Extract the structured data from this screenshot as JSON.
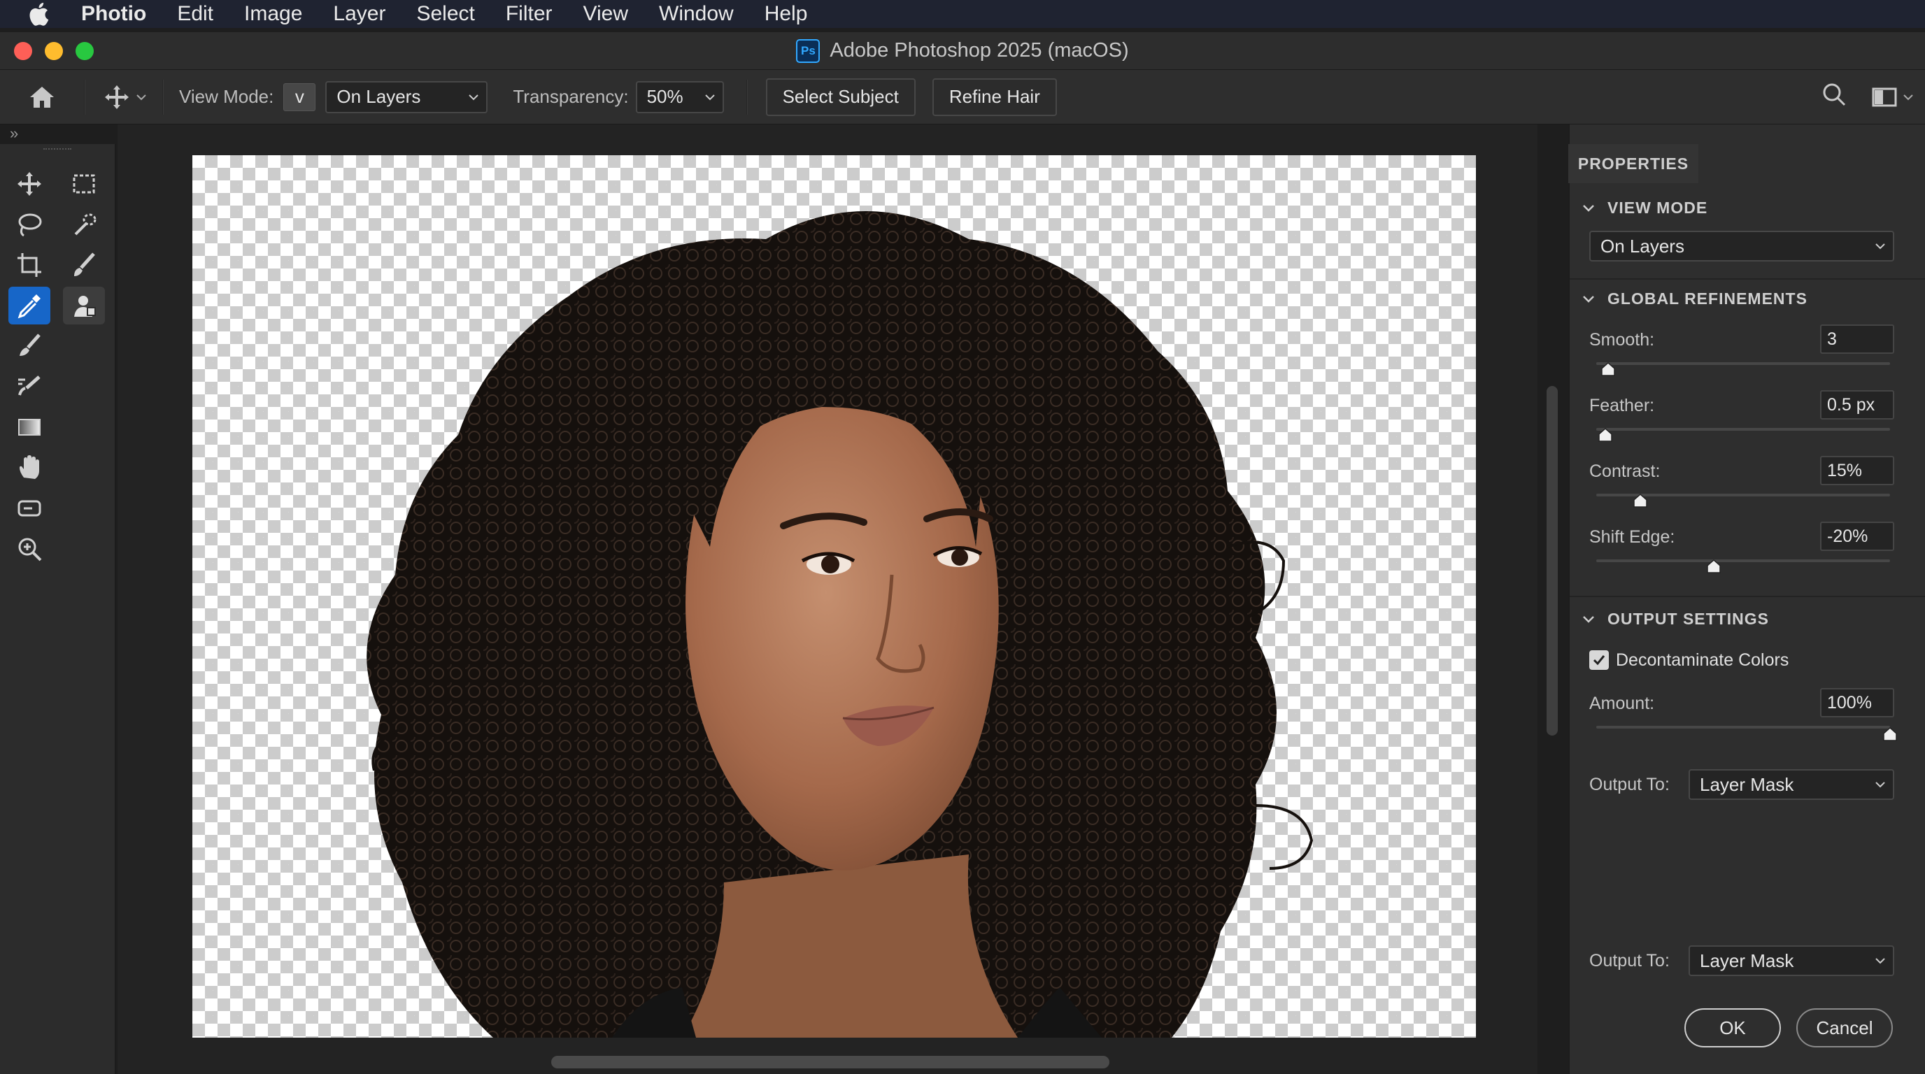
{
  "menubar": {
    "app": "Photio",
    "items": [
      "Edit",
      "Image",
      "Layer",
      "Select",
      "Filter",
      "View",
      "Window",
      "Help"
    ]
  },
  "window": {
    "title": "Adobe Photoshop 2025 (macOS)",
    "ps_badge": "Ps"
  },
  "options": {
    "view_mode_label": "View Mode:",
    "view_mode_key": "v",
    "view_mode_value": "On Layers",
    "transparency_label": "Transparency:",
    "transparency_value": "50%",
    "select_subject": "Select Subject",
    "refine_hair": "Refine Hair"
  },
  "collapse": {
    "left": "»",
    "right": "«"
  },
  "panel": {
    "tab": "PROPERTIES",
    "view_mode": {
      "heading": "VIEW MODE",
      "value": "On Layers"
    },
    "global": {
      "heading": "GLOBAL REFINEMENTS",
      "smooth": {
        "label": "Smooth:",
        "value": "3",
        "level": 0.04
      },
      "feather": {
        "label": "Feather:",
        "value": "0.5 px",
        "level": 0.03
      },
      "contrast": {
        "label": "Contrast:",
        "value": "15%",
        "level": 0.15
      },
      "shift_edge": {
        "label": "Shift Edge:",
        "value": "-20%",
        "level": 0.4
      }
    },
    "output": {
      "heading": "OUTPUT SETTINGS",
      "decontaminate": "Decontaminate Colors",
      "decontaminate_checked": true,
      "amount": {
        "label": "Amount:",
        "value": "100%",
        "level": 1.0
      },
      "output_to_label": "Output To:",
      "output_to_value": "Layer Mask"
    },
    "output2": {
      "label": "Output To:",
      "value": "Layer Mask"
    },
    "ok": "OK",
    "cancel": "Cancel"
  },
  "colors": {
    "accent": "#1766c8",
    "traffic_red": "#fe5f57",
    "traffic_yellow": "#febc2e",
    "traffic_green": "#28c840"
  }
}
